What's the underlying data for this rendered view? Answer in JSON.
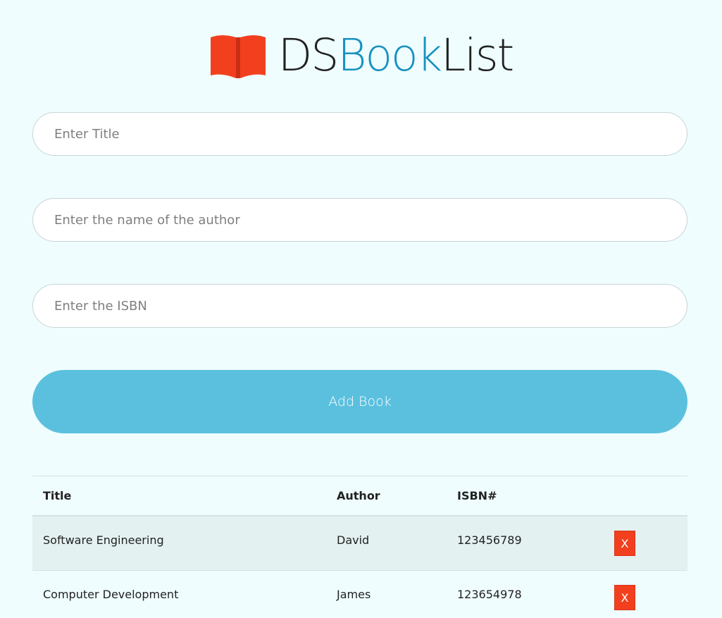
{
  "brand": {
    "icon": "book-icon",
    "name_part1": "DS",
    "name_part2": "Book",
    "name_part3": "List",
    "colors": {
      "icon": "#f2401f",
      "accent": "#1791c0",
      "text": "#222222"
    }
  },
  "form": {
    "title_placeholder": "Enter Title",
    "author_placeholder": "Enter the name of the author",
    "isbn_placeholder": "Enter the ISBN",
    "title_value": "",
    "author_value": "",
    "isbn_value": "",
    "submit_label": "Add Book",
    "submit_color": "#5bc0de"
  },
  "table": {
    "headers": {
      "title": "Title",
      "author": "Author",
      "isbn": "ISBN#"
    },
    "rows": [
      {
        "title": "Software Engineering",
        "author": "David",
        "isbn": "123456789",
        "delete_label": "X"
      },
      {
        "title": "Computer Development",
        "author": "James",
        "isbn": "123654978",
        "delete_label": "X"
      }
    ],
    "delete_color": "#f2401f"
  }
}
